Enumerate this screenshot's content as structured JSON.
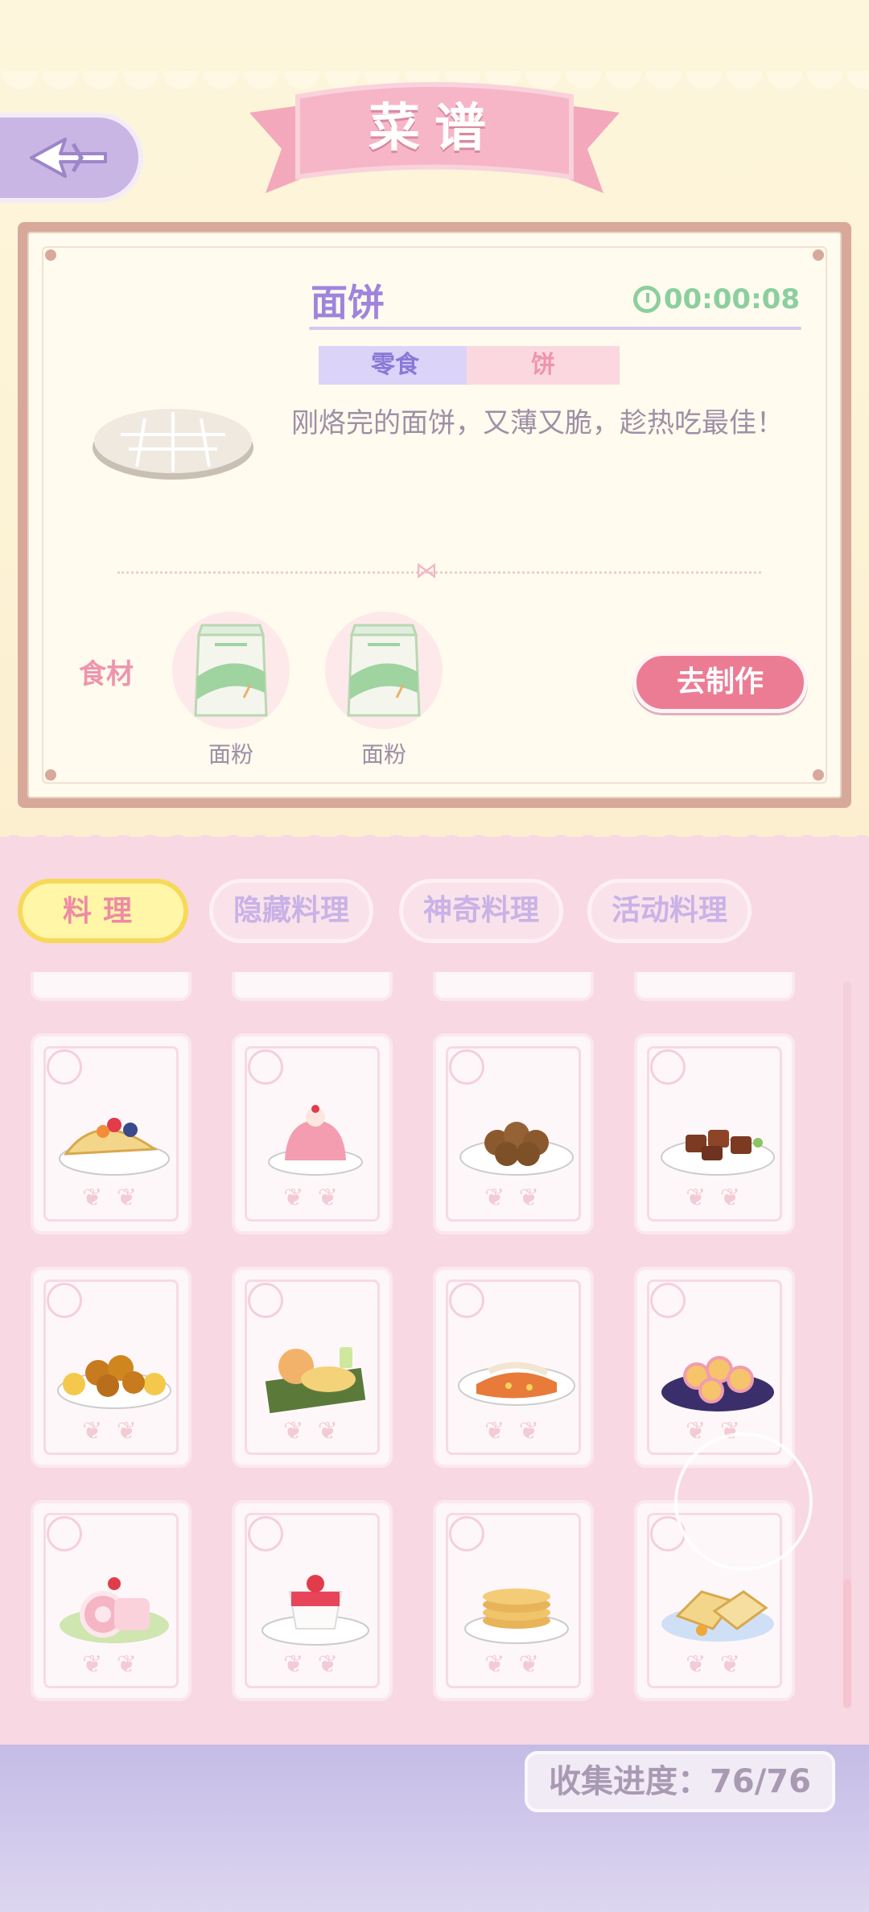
{
  "header": {
    "title": "菜谱"
  },
  "detail": {
    "name": "面饼",
    "timer": "00:00:08",
    "tags": [
      "零食",
      "饼"
    ],
    "description": "刚烙完的面饼，又薄又脆，趁热吃最佳！",
    "ingredients_label": "食材",
    "ingredients": [
      {
        "name": "面粉",
        "icon": "flour-bag-icon"
      },
      {
        "name": "面粉",
        "icon": "flour-bag-icon"
      }
    ],
    "make_button": "去制作"
  },
  "tabs": [
    {
      "label": "料理",
      "active": true
    },
    {
      "label": "隐藏料理",
      "active": false
    },
    {
      "label": "神奇料理",
      "active": false
    },
    {
      "label": "活动料理",
      "active": false
    }
  ],
  "recipes": [
    {
      "icon": "taco-dish-icon"
    },
    {
      "icon": "pink-jelly-dish-icon"
    },
    {
      "icon": "meatballs-dish-icon"
    },
    {
      "icon": "braised-pork-dish-icon"
    },
    {
      "icon": "lemon-chicken-dish-icon"
    },
    {
      "icon": "fish-platter-dish-icon"
    },
    {
      "icon": "grilled-fish-dish-icon"
    },
    {
      "icon": "bread-rolls-dish-icon"
    },
    {
      "icon": "swiss-roll-dish-icon"
    },
    {
      "icon": "strawberry-pudding-dish-icon"
    },
    {
      "icon": "pancakes-dish-icon"
    },
    {
      "icon": "toast-dish-icon"
    }
  ],
  "progress": {
    "label": "收集进度：76/76",
    "collected": 76,
    "total": 76
  },
  "colors": {
    "accent_purple": "#a084dc",
    "accent_pink": "#ec7c94",
    "timer_green": "#8ccf9f",
    "active_tab": "#fff6a8"
  }
}
